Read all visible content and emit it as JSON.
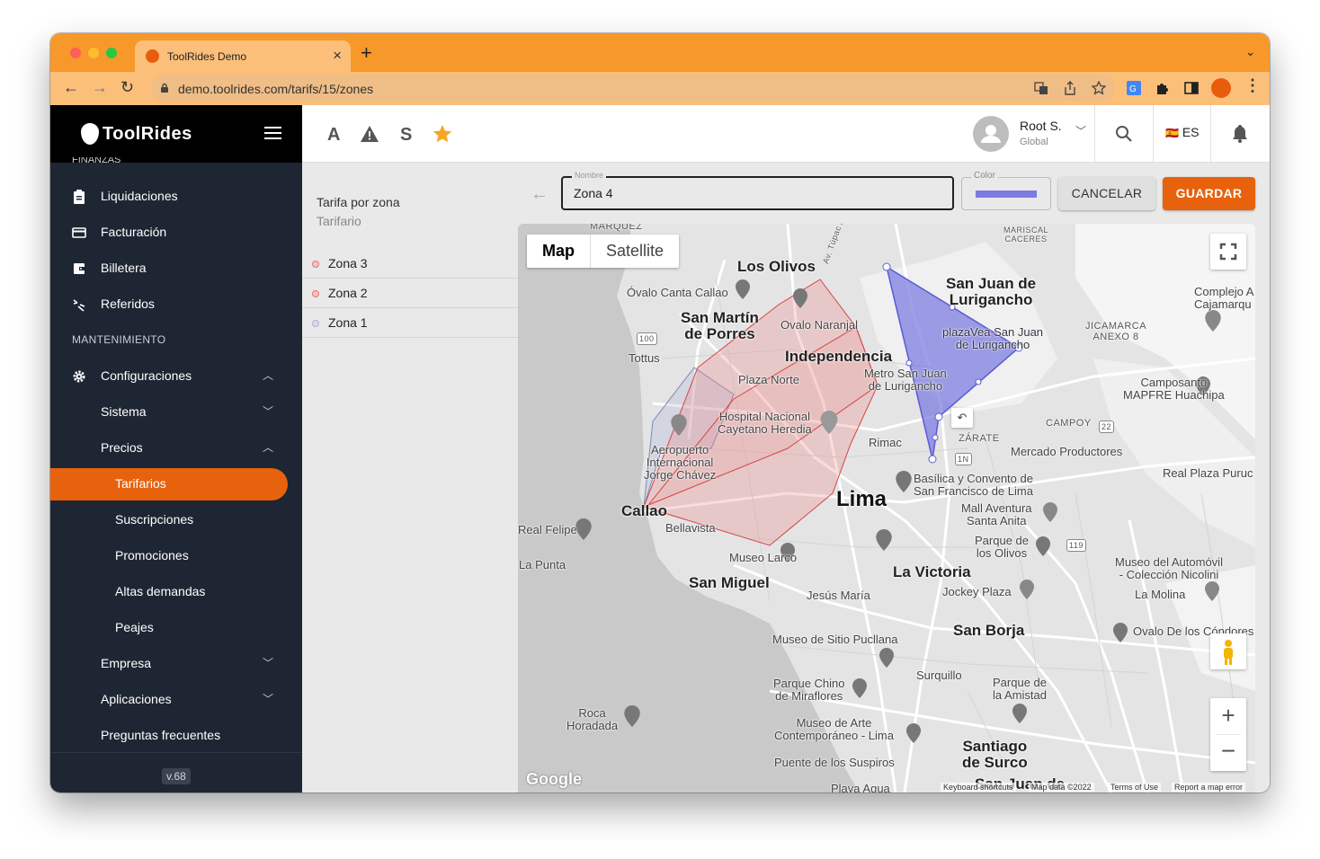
{
  "browser": {
    "tab_title": "ToolRides Demo",
    "url": "demo.toolrides.com/tarifs/15/zones"
  },
  "sidebar": {
    "brand": "ToolRides",
    "cut_item": "FINANZAS",
    "items": [
      {
        "label": "Liquidaciones"
      },
      {
        "label": "Facturación"
      },
      {
        "label": "Billetera"
      },
      {
        "label": "Referidos"
      }
    ],
    "section_label": "MANTENIMIENTO",
    "config": {
      "label": "Configuraciones"
    },
    "sub": [
      {
        "label": "Sistema"
      },
      {
        "label": "Precios"
      }
    ],
    "precios_items": [
      {
        "label": "Tarifarios"
      },
      {
        "label": "Suscripciones"
      },
      {
        "label": "Promociones"
      },
      {
        "label": "Altas demandas"
      },
      {
        "label": "Peajes"
      }
    ],
    "more": [
      {
        "label": "Empresa"
      },
      {
        "label": "Aplicaciones"
      },
      {
        "label": "Preguntas frecuentes"
      }
    ],
    "version": "v.68"
  },
  "topbar": {
    "letters": [
      "A",
      "S"
    ],
    "user_name": "Root S.",
    "user_role": "Global",
    "language": "ES",
    "flag": "🇪🇸"
  },
  "list": {
    "title": "Tarifa por zona",
    "subtitle": "Tarifario",
    "zones": [
      {
        "label": "Zona 3",
        "color": "#e57373"
      },
      {
        "label": "Zona 2",
        "color": "#e57373"
      },
      {
        "label": "Zona 1",
        "color": "#b0b0d8"
      }
    ]
  },
  "form": {
    "name_label": "Nombre",
    "name_value": "Zona 4",
    "color_label": "Color",
    "color_value": "#7c7ce0",
    "cancel": "CANCELAR",
    "save": "GUARDAR"
  },
  "map": {
    "map_button": "Map",
    "satellite_button": "Satellite",
    "labels": {
      "los_olivos": "Los Olivos",
      "ovalo_canta": "Óvalo Canta Callao",
      "san_martin": "San Martín\nde Porres",
      "ovalo_naranjal": "Ovalo Naranjal",
      "independencia": "Independencia",
      "tottus": "Tottus",
      "plaza_norte": "Plaza Norte",
      "hospital": "Hospital Nacional\nCayetano Heredia",
      "aeropuerto": "Aeropuerto\nInternacional\nJorge Chávez",
      "callao": "Callao",
      "bellavista": "Bellavista",
      "real_felipe": "Real Felipe",
      "la_punta": "La Punta",
      "museo_larco": "Museo Larco",
      "san_miguel": "San Miguel",
      "lima": "Lima",
      "rimac": "Rimac",
      "jesus_maria": "Jesús María",
      "la_victoria": "La Victoria",
      "san_juan": "San Juan de\nLurigancho",
      "plazavea": "plazaVea San Juan\nde Lurigancho",
      "metro": "Metro San Juan\nde Lurigancho",
      "mariscal": "MARISCAL\nCACERES",
      "jicamarca": "JICAMARCA\nANEXO 8",
      "complejo": "Complejo A\nCajamarqu",
      "camposanto": "Camposanto\nMAPFRE Huachipa",
      "campoy": "CAMPOY",
      "zarate": "ZÁRATE",
      "mercado": "Mercado Productores",
      "basilica": "Basílica y Convento de\nSan Francisco de Lima",
      "real_plaza": "Real Plaza Puruc",
      "mall": "Mall Aventura\nSanta Anita",
      "parque_olivos": "Parque de\nlos Olivos",
      "museo_auto": "Museo del Automóvil\n- Colección Nicolini",
      "jockey": "Jockey Plaza",
      "la_molina": "La Molina",
      "san_borja": "San Borja",
      "ovalo_condores": "Ovalo De los Cóndores",
      "pucllana": "Museo de Sitio Pucllana",
      "surquillo": "Surquillo",
      "parque_chino": "Parque Chino\nde Miraflores",
      "parque_amistad": "Parque de\nla Amistad",
      "roca": "Roca\nHoradada",
      "museo_arte": "Museo de Arte\nContemporáneo - Lima",
      "santiago": "Santiago\nde Surco",
      "puente": "Puente de los Suspiros",
      "playa": "Playa Agua",
      "san_juan_de": "San Juan de",
      "marquez": "MARQUEZ",
      "av_tupac": "Av. Túpac Amaru",
      "r100": "100",
      "r22": "22",
      "r1n": "1N",
      "r119": "119"
    },
    "google": "Google",
    "attribution": {
      "shortcuts": "Keyboard shortcuts",
      "data": "Map data ©2022",
      "terms": "Terms of Use",
      "report": "Report a map error"
    },
    "zone_colors": {
      "zona3": "#e53935",
      "zona1": "#6a7fb5",
      "zona4": "#6b6bdf"
    }
  }
}
